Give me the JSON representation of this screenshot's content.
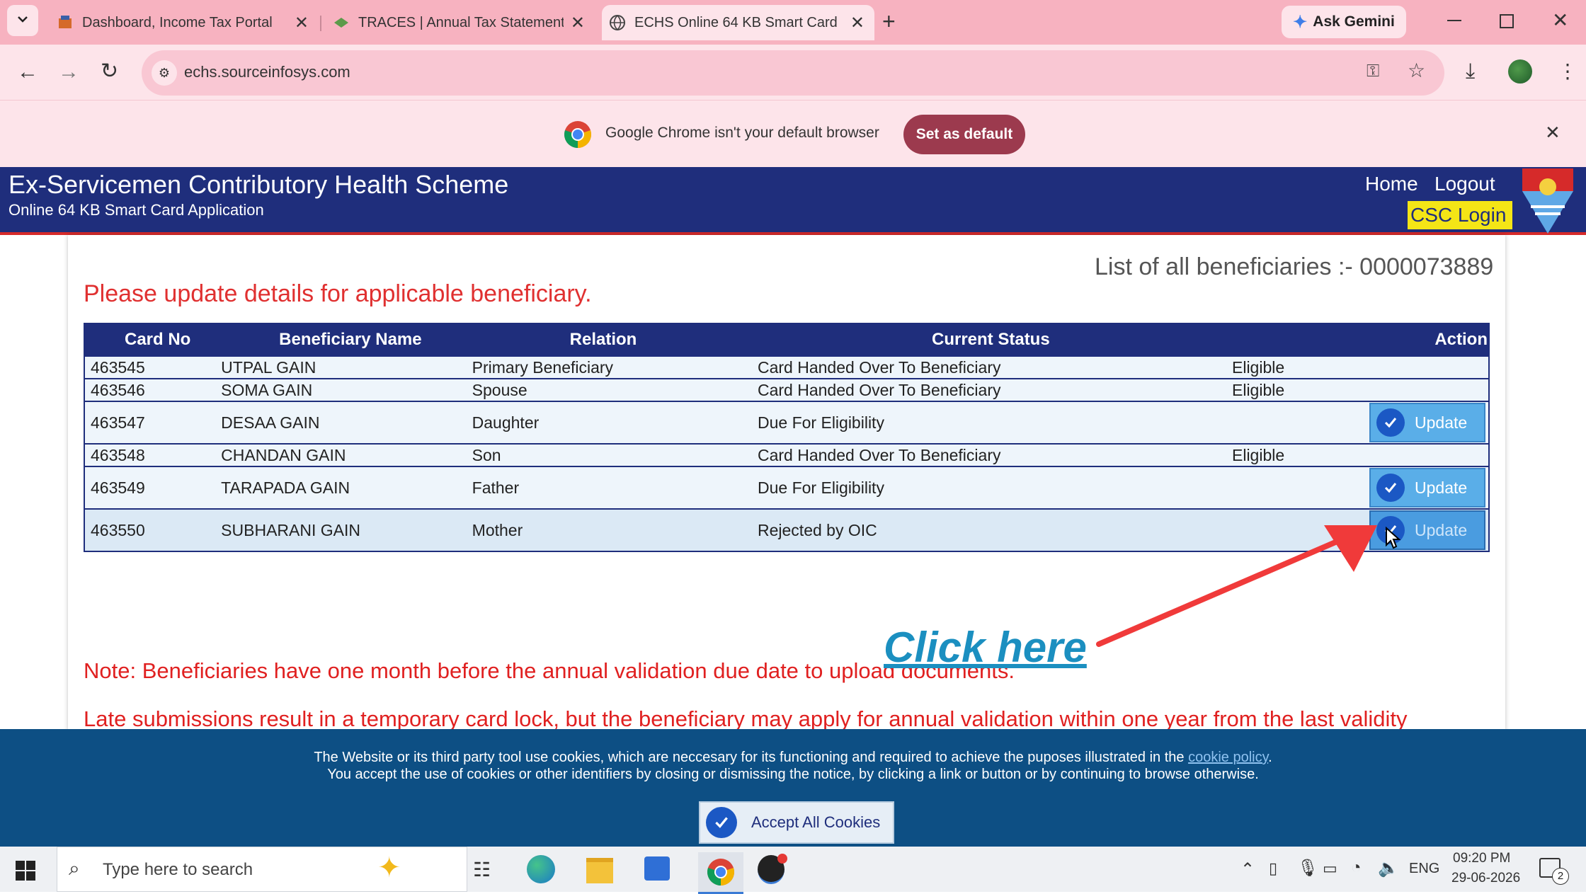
{
  "browser": {
    "tabs": [
      {
        "title": "Dashboard, Income Tax Portal, G",
        "icon": "tax-portal-icon"
      },
      {
        "title": "TRACES | Annual Tax Statement",
        "icon": "traces-icon"
      },
      {
        "title": "ECHS Online 64 KB Smart Card",
        "icon": "globe-icon"
      }
    ],
    "ask_gemini": "Ask Gemini",
    "url": "echs.sourceinfosys.com",
    "infobar_text": "Google Chrome isn't your default browser",
    "infobar_button": "Set as default"
  },
  "site": {
    "title": "Ex-Servicemen Contributory Health Scheme",
    "subtitle": "Online 64 KB Smart Card Application",
    "nav": {
      "home": "Home",
      "logout": "Logout",
      "csc_login": "CSC Login"
    }
  },
  "main": {
    "list_label": "List of all beneficiaries :- 0000073889",
    "instruction": "Please update details for applicable beneficiary.",
    "columns": [
      "Card No",
      "Beneficiary Name",
      "Relation",
      "Current Status",
      "Action"
    ],
    "rows": [
      {
        "card": "463545",
        "name": "UTPAL GAIN",
        "relation": "Primary Beneficiary",
        "status": "Card Handed Over To Beneficiary",
        "eligibility": "Eligible",
        "action": ""
      },
      {
        "card": "463546",
        "name": "SOMA GAIN",
        "relation": "Spouse",
        "status": "Card Handed Over To Beneficiary",
        "eligibility": "Eligible",
        "action": ""
      },
      {
        "card": "463547",
        "name": "DESAA GAIN",
        "relation": "Daughter",
        "status": "Due For Eligibility",
        "eligibility": "",
        "action": "Update"
      },
      {
        "card": "463548",
        "name": "CHANDAN GAIN",
        "relation": "Son",
        "status": "Card Handed Over To Beneficiary",
        "eligibility": "Eligible",
        "action": ""
      },
      {
        "card": "463549",
        "name": "TARAPADA GAIN",
        "relation": "Father",
        "status": "Due For Eligibility",
        "eligibility": "",
        "action": "Update"
      },
      {
        "card": "463550",
        "name": "SUBHARANI GAIN",
        "relation": "Mother",
        "status": "Rejected by OIC",
        "eligibility": "",
        "action": "Update"
      }
    ],
    "note1": "Note: Beneficiaries have one month before the annual validation due date to upload documents.",
    "note2": "Late submissions result in a temporary card lock, but the beneficiary may apply for annual validation within one year from the last validity",
    "annotation": "Click here"
  },
  "cookies": {
    "line1_pre": "The Website or its third party tool use cookies, which are neccesary for its functioning and required to achieve the puposes illustrated in the",
    "line1_link": "cookie policy",
    "line1_post": ".",
    "line2": "You accept the use of cookies or other identifiers by closing or dismissing the notice, by clicking a link or button or by continuing to browse otherwise.",
    "accept": "Accept All Cookies"
  },
  "taskbar": {
    "search_placeholder": "Type here to search",
    "lang": "ENG",
    "time": "09:20 PM",
    "date": "29-06-2026",
    "notif_count": "2"
  },
  "colors": {
    "header_blue": "#1f2e7c",
    "accent_red": "#d62a2a",
    "button_blue": "#5aaee8",
    "annotation": "#1b8fc0"
  }
}
